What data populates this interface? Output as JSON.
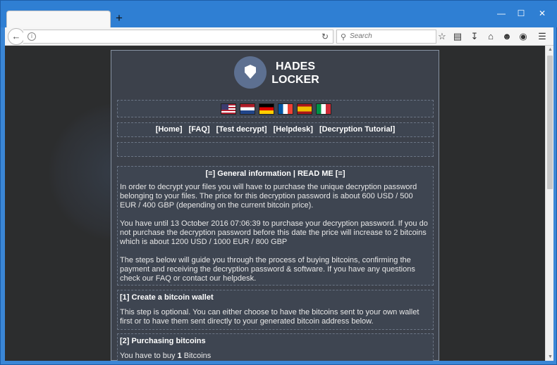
{
  "browser": {
    "tab_title": "",
    "new_tab_symbol": "+",
    "window_controls": [
      "—",
      "☐",
      "✕"
    ],
    "url": "",
    "search_placeholder": "Search",
    "toolbar_icons": [
      "star-icon",
      "reader-icon",
      "download-icon",
      "home-icon",
      "smiley-icon",
      "pocket-icon",
      "menu-icon"
    ]
  },
  "page": {
    "logo_line1": "HADES",
    "logo_line2": "LOCKER",
    "nav": [
      "[Home]",
      "[FAQ]",
      "[Test decrypt]",
      "[Helpdesk]",
      "[Decryption Tutorial]"
    ],
    "info": {
      "heading": "[=] General information | READ ME [=]",
      "p1": "In order to decrypt your files you will have to purchase the unique decryption password belonging to your files. The price for this decryption password is about 600 USD / 500 EUR / 400 GBP (depending on the current bitcoin price).",
      "p2": "You have until 13 October 2016 07:06:39 to purchase your decryption password. If you do not purchase the decryption password before this date the price will increase to 2 bitcoins which is about 1200 USD / 1000 EUR / 800 GBP",
      "p3": "The steps below will guide you through the process of buying bitcoins, confirming the payment and receiving the decryption password & software. If you have any questions check our FAQ or contact our helpdesk."
    },
    "step1": {
      "heading": "[1] Create a bitcoin wallet",
      "text": "This step is optional. You can either choose to have the bitcoins sent to your own wallet first or to have them sent directly to your generated bitcoin address below."
    },
    "step2": {
      "heading": "[2] Purchasing bitcoins",
      "text_prefix": "You have to buy",
      "amount": "1",
      "text_suffix": "Bitcoins"
    }
  }
}
